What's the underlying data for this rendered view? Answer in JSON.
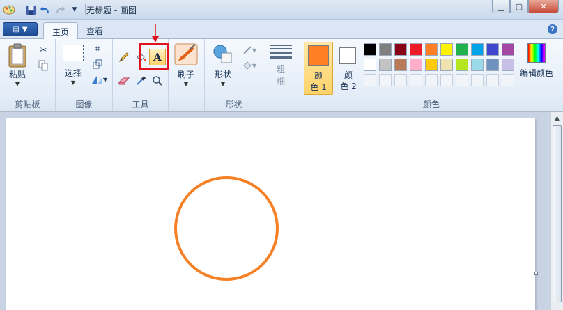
{
  "window": {
    "title": "无标题 - 画图"
  },
  "tabs": [
    {
      "label": "主页"
    },
    {
      "label": "查看"
    }
  ],
  "help": {
    "label": "?"
  },
  "groups": {
    "clipboard": {
      "label": "剪贴板",
      "paste": "粘贴"
    },
    "image": {
      "label": "图像",
      "select": "选择"
    },
    "tools": {
      "label": "工具",
      "text_tool": "A"
    },
    "brushes": {
      "label": "刷子"
    },
    "shapes": {
      "label": "形状",
      "shapes_btn": "形状"
    },
    "size": {
      "label_line1": "粗",
      "label_line2": "细"
    },
    "colors": {
      "label": "颜色",
      "color1_line1": "颜",
      "color1_line2": "色 1",
      "color2_line1": "颜",
      "color2_line2": "色 2",
      "edit_colors": "编辑颜色",
      "color1_value": "#ff7f27",
      "color2_value": "#ffffff",
      "palette_row1": [
        "#000000",
        "#7f7f7f",
        "#880015",
        "#ed1c24",
        "#ff7f27",
        "#fff200",
        "#22b14c",
        "#00a2e8",
        "#3f48cc",
        "#a349a4"
      ],
      "palette_row2": [
        "#ffffff",
        "#c3c3c3",
        "#b97a57",
        "#ffaec9",
        "#ffc90e",
        "#efe4b0",
        "#b5e61d",
        "#99d9ea",
        "#7092be",
        "#c8bfe7"
      ]
    }
  },
  "canvas": {
    "circle_color": "#f58025"
  },
  "annotation": {
    "color": "#e0141e"
  }
}
